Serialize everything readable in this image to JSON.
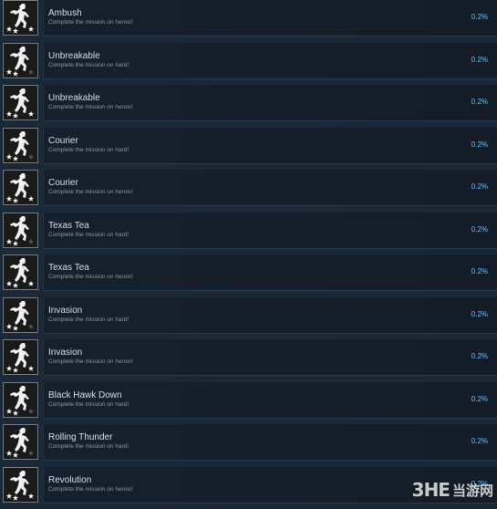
{
  "achievements": [
    {
      "title": "Ambush",
      "description": "Complete the mission on heroic!",
      "percent": "0.2%",
      "stars": 3
    },
    {
      "title": "Unbreakable",
      "description": "Complete the mission on hard!",
      "percent": "0.2%",
      "stars": 2
    },
    {
      "title": "Unbreakable",
      "description": "Complete the mission on heroic!",
      "percent": "0.2%",
      "stars": 3
    },
    {
      "title": "Courier",
      "description": "Complete the mission on hard!",
      "percent": "0.2%",
      "stars": 2
    },
    {
      "title": "Courier",
      "description": "Complete the mission on heroic!",
      "percent": "0.2%",
      "stars": 3
    },
    {
      "title": "Texas Tea",
      "description": "Complete the mission on hard!",
      "percent": "0.2%",
      "stars": 2
    },
    {
      "title": "Texas Tea",
      "description": "Complete the mission on heroic!",
      "percent": "0.2%",
      "stars": 3
    },
    {
      "title": "Invasion",
      "description": "Complete the mission on hard!",
      "percent": "0.2%",
      "stars": 2
    },
    {
      "title": "Invasion",
      "description": "Complete the mission on heroic!",
      "percent": "0.2%",
      "stars": 3
    },
    {
      "title": "Black Hawk Down",
      "description": "Complete the mission on hard!",
      "percent": "0.2%",
      "stars": 2
    },
    {
      "title": "Rolling Thunder",
      "description": "Complete the mission on hard!",
      "percent": "0.2%",
      "stars": 2
    },
    {
      "title": "Revolution",
      "description": "Complete the mission on heroic!",
      "percent": "0.2%",
      "stars": 3
    }
  ],
  "watermark": {
    "logo": "3HE",
    "text": "当游网"
  },
  "colors": {
    "background": "#1b2838",
    "percent": "#66c0f4",
    "title": "#d8dde2",
    "description": "#8a97a4"
  }
}
